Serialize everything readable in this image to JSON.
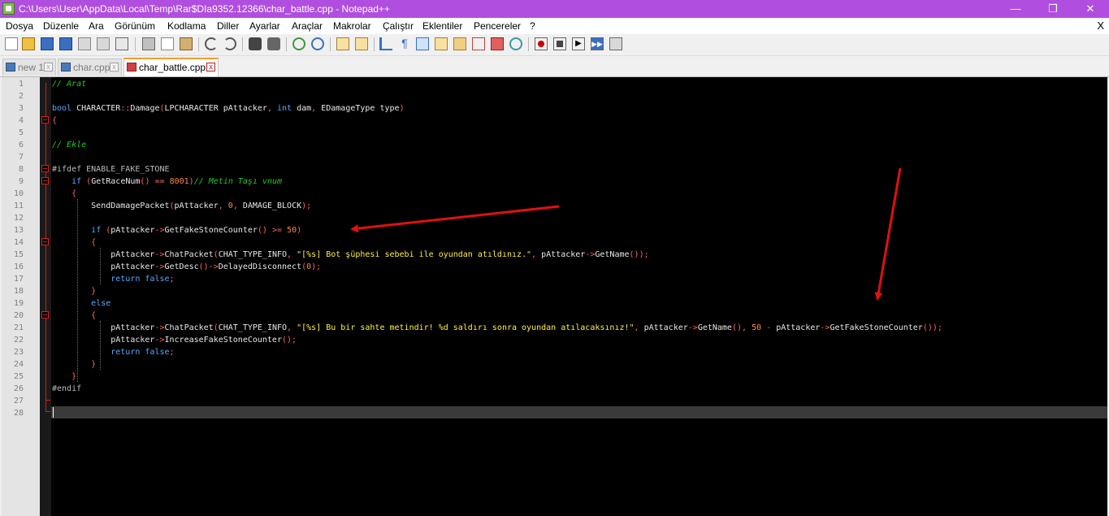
{
  "window": {
    "title": "C:\\Users\\User\\AppData\\Local\\Temp\\Rar$DIa9352.12366\\char_battle.cpp - Notepad++",
    "minimize": "—",
    "maximize": "❐",
    "close": "✕"
  },
  "menu": {
    "items": [
      "Dosya",
      "Düzenle",
      "Ara",
      "Görünüm",
      "Kodlama",
      "Diller",
      "Ayarlar",
      "Araçlar",
      "Makrolar",
      "Çalıştır",
      "Eklentiler",
      "Pencereler",
      "?"
    ],
    "close_doc": "X"
  },
  "tabs": [
    {
      "label": "new 1",
      "active": false
    },
    {
      "label": "char.cpp",
      "active": false
    },
    {
      "label": "char_battle.cpp",
      "active": true
    }
  ],
  "tab_close": "x",
  "editor": {
    "line_numbers": [
      "1",
      "2",
      "3",
      "4",
      "5",
      "6",
      "7",
      "8",
      "9",
      "10",
      "11",
      "12",
      "13",
      "14",
      "15",
      "16",
      "17",
      "18",
      "19",
      "20",
      "21",
      "22",
      "23",
      "24",
      "25",
      "26",
      "27",
      "28"
    ],
    "current_line": 28,
    "lines": [
      [
        {
          "c": "c",
          "t": "// Arat"
        }
      ],
      [],
      [
        {
          "c": "k",
          "t": "bool"
        },
        {
          "c": "t",
          "t": " CHARACTER"
        },
        {
          "c": "o",
          "t": "::"
        },
        {
          "c": "t",
          "t": "Damage"
        },
        {
          "c": "o",
          "t": "("
        },
        {
          "c": "t",
          "t": "LPCHARACTER pAttacker"
        },
        {
          "c": "o",
          "t": ","
        },
        {
          "c": "t",
          "t": " "
        },
        {
          "c": "k",
          "t": "int"
        },
        {
          "c": "t",
          "t": " dam"
        },
        {
          "c": "o",
          "t": ","
        },
        {
          "c": "t",
          "t": " EDamageType type"
        },
        {
          "c": "o",
          "t": ")"
        }
      ],
      [
        {
          "c": "o",
          "t": "{"
        }
      ],
      [],
      [
        {
          "c": "c",
          "t": "// Ekle"
        }
      ],
      [],
      [
        {
          "c": "p",
          "t": "#ifdef ENABLE_FAKE_STONE"
        }
      ],
      [
        {
          "c": "t",
          "t": "    "
        },
        {
          "c": "k",
          "t": "if"
        },
        {
          "c": "t",
          "t": " "
        },
        {
          "c": "o",
          "t": "("
        },
        {
          "c": "t",
          "t": "GetRaceNum"
        },
        {
          "c": "o",
          "t": "()"
        },
        {
          "c": "t",
          "t": " "
        },
        {
          "c": "o",
          "t": "=="
        },
        {
          "c": "t",
          "t": " "
        },
        {
          "c": "n",
          "t": "8001"
        },
        {
          "c": "o",
          "t": ")"
        },
        {
          "c": "c",
          "t": "// Metin Taşı vnum"
        }
      ],
      [
        {
          "c": "t",
          "t": "    "
        },
        {
          "c": "o",
          "t": "{"
        }
      ],
      [
        {
          "c": "t",
          "t": "        SendDamagePacket"
        },
        {
          "c": "o",
          "t": "("
        },
        {
          "c": "t",
          "t": "pAttacker"
        },
        {
          "c": "o",
          "t": ","
        },
        {
          "c": "t",
          "t": " "
        },
        {
          "c": "n",
          "t": "0"
        },
        {
          "c": "o",
          "t": ","
        },
        {
          "c": "t",
          "t": " DAMAGE_BLOCK"
        },
        {
          "c": "o",
          "t": ");"
        }
      ],
      [],
      [
        {
          "c": "t",
          "t": "        "
        },
        {
          "c": "k",
          "t": "if"
        },
        {
          "c": "t",
          "t": " "
        },
        {
          "c": "o",
          "t": "("
        },
        {
          "c": "t",
          "t": "pAttacker"
        },
        {
          "c": "o",
          "t": "->"
        },
        {
          "c": "t",
          "t": "GetFakeStoneCounter"
        },
        {
          "c": "o",
          "t": "()"
        },
        {
          "c": "t",
          "t": " "
        },
        {
          "c": "o",
          "t": ">="
        },
        {
          "c": "t",
          "t": " "
        },
        {
          "c": "n",
          "t": "50"
        },
        {
          "c": "o",
          "t": ")"
        }
      ],
      [
        {
          "c": "t",
          "t": "        "
        },
        {
          "c": "o",
          "t": "{"
        }
      ],
      [
        {
          "c": "t",
          "t": "            pAttacker"
        },
        {
          "c": "o",
          "t": "->"
        },
        {
          "c": "t",
          "t": "ChatPacket"
        },
        {
          "c": "o",
          "t": "("
        },
        {
          "c": "t",
          "t": "CHAT_TYPE_INFO"
        },
        {
          "c": "o",
          "t": ","
        },
        {
          "c": "t",
          "t": " "
        },
        {
          "c": "s",
          "t": "\"[%s] Bot şüphesi sebebi ile oyundan atıldınız.\""
        },
        {
          "c": "o",
          "t": ","
        },
        {
          "c": "t",
          "t": " pAttacker"
        },
        {
          "c": "o",
          "t": "->"
        },
        {
          "c": "t",
          "t": "GetName"
        },
        {
          "c": "o",
          "t": "());"
        }
      ],
      [
        {
          "c": "t",
          "t": "            pAttacker"
        },
        {
          "c": "o",
          "t": "->"
        },
        {
          "c": "t",
          "t": "GetDesc"
        },
        {
          "c": "o",
          "t": "()->"
        },
        {
          "c": "t",
          "t": "DelayedDisconnect"
        },
        {
          "c": "o",
          "t": "("
        },
        {
          "c": "n",
          "t": "0"
        },
        {
          "c": "o",
          "t": ");"
        }
      ],
      [
        {
          "c": "t",
          "t": "            "
        },
        {
          "c": "k",
          "t": "return"
        },
        {
          "c": "t",
          "t": " "
        },
        {
          "c": "k",
          "t": "false"
        },
        {
          "c": "o",
          "t": ";"
        }
      ],
      [
        {
          "c": "t",
          "t": "        "
        },
        {
          "c": "o",
          "t": "}"
        }
      ],
      [
        {
          "c": "t",
          "t": "        "
        },
        {
          "c": "k",
          "t": "else"
        }
      ],
      [
        {
          "c": "t",
          "t": "        "
        },
        {
          "c": "o",
          "t": "{"
        }
      ],
      [
        {
          "c": "t",
          "t": "            pAttacker"
        },
        {
          "c": "o",
          "t": "->"
        },
        {
          "c": "t",
          "t": "ChatPacket"
        },
        {
          "c": "o",
          "t": "("
        },
        {
          "c": "t",
          "t": "CHAT_TYPE_INFO"
        },
        {
          "c": "o",
          "t": ","
        },
        {
          "c": "t",
          "t": " "
        },
        {
          "c": "s",
          "t": "\"[%s] Bu bir sahte metindir! %d saldırı sonra oyundan atılacaksınız!\""
        },
        {
          "c": "o",
          "t": ","
        },
        {
          "c": "t",
          "t": " pAttacker"
        },
        {
          "c": "o",
          "t": "->"
        },
        {
          "c": "t",
          "t": "GetName"
        },
        {
          "c": "o",
          "t": "(),"
        },
        {
          "c": "t",
          "t": " "
        },
        {
          "c": "n",
          "t": "50"
        },
        {
          "c": "t",
          "t": " "
        },
        {
          "c": "o",
          "t": "-"
        },
        {
          "c": "t",
          "t": " pAttacker"
        },
        {
          "c": "o",
          "t": "->"
        },
        {
          "c": "t",
          "t": "GetFakeStoneCounter"
        },
        {
          "c": "o",
          "t": "());"
        }
      ],
      [
        {
          "c": "t",
          "t": "            pAttacker"
        },
        {
          "c": "o",
          "t": "->"
        },
        {
          "c": "t",
          "t": "IncreaseFakeStoneCounter"
        },
        {
          "c": "o",
          "t": "();"
        }
      ],
      [
        {
          "c": "t",
          "t": "            "
        },
        {
          "c": "k",
          "t": "return"
        },
        {
          "c": "t",
          "t": " "
        },
        {
          "c": "k",
          "t": "false"
        },
        {
          "c": "o",
          "t": ";"
        }
      ],
      [
        {
          "c": "t",
          "t": "        "
        },
        {
          "c": "o",
          "t": "}"
        }
      ],
      [
        {
          "c": "t",
          "t": "    "
        },
        {
          "c": "o",
          "t": "}"
        }
      ],
      [
        {
          "c": "p",
          "t": "#endif"
        }
      ],
      [],
      []
    ]
  },
  "colors": {
    "titlebar": "#b04ee0",
    "editor_bg": "#000000",
    "keyword": "#55aaff",
    "comment": "#22cc22",
    "number": "#ff8844",
    "string": "#ffee44",
    "annotation_arrow": "#e01010"
  }
}
